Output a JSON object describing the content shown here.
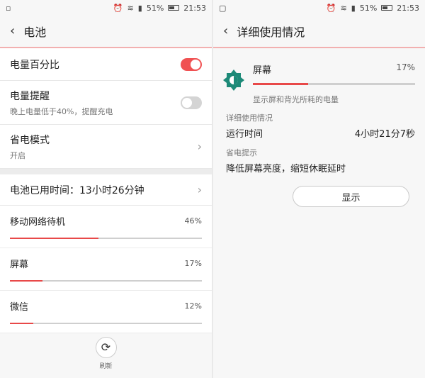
{
  "status_bar": {
    "battery_percent": "51%",
    "time": "21:53"
  },
  "left": {
    "title": "电池",
    "settings": {
      "percent_label": "电量百分比",
      "reminder_label": "电量提醒",
      "reminder_sub": "晚上电量低于40%，提醒充电",
      "saver_label": "省电模式",
      "saver_sub": "开启",
      "usage_time_label": "电池已用时间：13小时26分钟"
    },
    "apps": [
      {
        "name": "移动网络待机",
        "pct": "46%",
        "value": 46
      },
      {
        "name": "屏幕",
        "pct": "17%",
        "value": 17
      },
      {
        "name": "微信",
        "pct": "12%",
        "value": 12
      }
    ],
    "refresh_label": "刷新"
  },
  "right": {
    "title": "详细使用情况",
    "app_name": "屏幕",
    "pct": "17%",
    "value": 17,
    "desc": "显示屏和背光所耗的电量",
    "detail_label": "详细使用情况",
    "run_time_label": "运行时间",
    "run_time_value": "4小时21分7秒",
    "tip_label": "省电提示",
    "tip_text": "降低屏幕亮度，缩短休眠延时",
    "show_button": "显示"
  }
}
